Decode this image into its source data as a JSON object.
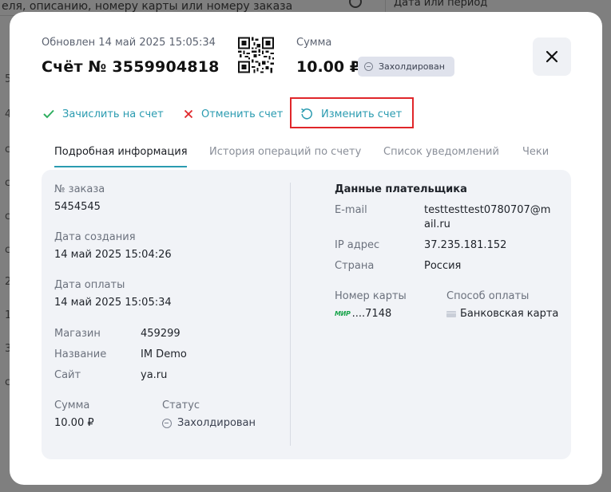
{
  "background": {
    "search_placeholder": "еля, описанию, номеру карты или номеру заказа",
    "date_placeholder": "Дата или период",
    "partial_rows": [
      "5",
      "4",
      "c",
      "c",
      "c",
      "c",
      "2",
      "1",
      "3",
      "c"
    ]
  },
  "header": {
    "updated": "Обновлен 14 май 2025 15:05:34",
    "title": "Счёт № 3559904818",
    "sum_label": "Сумма",
    "sum_value": "10.00 ₽",
    "status_badge": "Захолдирован"
  },
  "actions": {
    "credit": "Зачислить на счет",
    "cancel": "Отменить счет",
    "edit": "Изменить счет"
  },
  "tabs": [
    "Подробная информация",
    "История операций по счету",
    "Список уведомлений",
    "Чеки"
  ],
  "details": {
    "order_label": "№ заказа",
    "order_value": "5454545",
    "created_label": "Дата создания",
    "created_value": "14 май 2025 15:04:26",
    "paid_label": "Дата оплаты",
    "paid_value": "14 май 2025 15:05:34",
    "shop_label": "Магазин",
    "shop_value": "459299",
    "name_label": "Название",
    "name_value": "IM Demo",
    "site_label": "Сайт",
    "site_value": "ya.ru",
    "sum_label": "Сумма",
    "sum_value": "10.00 ₽",
    "status_label": "Статус",
    "status_value": "Захолдирован"
  },
  "payer": {
    "title": "Данные плательщика",
    "email_label": "E-mail",
    "email_line1": "testtesttest0780707@m",
    "email_line2": "ail.ru",
    "ip_label": "IP адрес",
    "ip_value": "37.235.181.152",
    "country_label": "Страна",
    "country_value": "Россия",
    "card_label": "Номер карты",
    "card_brand": "МИР",
    "card_value": "....7148",
    "method_label": "Способ оплаты",
    "method_value": "Банковская карта"
  },
  "colors": {
    "accent": "#2a9bb0",
    "cancel": "#e0262a",
    "highlight": "#e0262a"
  }
}
